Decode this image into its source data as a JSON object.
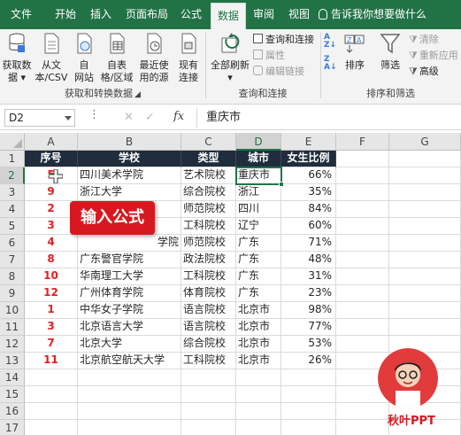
{
  "tabs": [
    "文件",
    "开始",
    "插入",
    "页面布局",
    "公式",
    "数据",
    "审阅",
    "视图"
  ],
  "active_tab": "数据",
  "tell_me": "告诉我你想要做什么",
  "ribbon": {
    "get_data": {
      "label1": "获取数",
      "label2": "据 ▾"
    },
    "from_text": {
      "label1": "从文",
      "label2": "本/CSV"
    },
    "from_web": {
      "label1": "自",
      "label2": "网站"
    },
    "from_table": {
      "label1": "自表",
      "label2": "格/区域"
    },
    "recent_sources": {
      "label1": "最近使",
      "label2": "用的源"
    },
    "existing_conn": {
      "label1": "现有",
      "label2": "连接"
    },
    "group1_label": "获取和转换数据",
    "refresh_all": {
      "label1": "全部刷新",
      "label2": "▾"
    },
    "queries_conn": "查询和连接",
    "properties": "属性",
    "edit_links": "编辑链接",
    "group2_label": "查询和连接",
    "sort": "排序",
    "filter": "筛选",
    "clear": "清除",
    "reapply": "重新应用",
    "advanced": "高级",
    "group3_label": "排序和筛选"
  },
  "formula_bar": {
    "name_box": "D2",
    "fx": "fx",
    "content": "重庆市"
  },
  "columns": [
    "A",
    "B",
    "C",
    "D",
    "E",
    "F",
    "G"
  ],
  "rows": [
    "1",
    "2",
    "3",
    "4",
    "5",
    "6",
    "7",
    "8",
    "9",
    "10",
    "11",
    "12",
    "13",
    "14",
    "15",
    "16",
    "17",
    "18"
  ],
  "sheet": {
    "headers": [
      "序号",
      "学校",
      "类型",
      "城市",
      "女生比例"
    ],
    "data": [
      [
        "5",
        "四川美术学院",
        "艺术院校",
        "重庆市",
        "66%"
      ],
      [
        "9",
        "浙江大学",
        "综合院校",
        "浙江",
        "35%"
      ],
      [
        "2",
        "",
        "师范院校",
        "四川",
        "84%"
      ],
      [
        "3",
        "",
        "工科院校",
        "辽宁",
        "60%"
      ],
      [
        "4",
        "学院",
        "师范院校",
        "广东",
        "71%"
      ],
      [
        "8",
        "广东警官学院",
        "政法院校",
        "广东",
        "48%"
      ],
      [
        "10",
        "华南理工大学",
        "工科院校",
        "广东",
        "31%"
      ],
      [
        "12",
        "广州体育学院",
        "体育院校",
        "广东",
        "23%"
      ],
      [
        "1",
        "中华女子学院",
        "语言院校",
        "北京市",
        "98%"
      ],
      [
        "3",
        "北京语言大学",
        "语言院校",
        "北京市",
        "77%"
      ],
      [
        "7",
        "北京大学",
        "综合院校",
        "北京市",
        "53%"
      ],
      [
        "11",
        "北京航空航天大学",
        "工科院校",
        "北京市",
        "26%"
      ]
    ]
  },
  "callout": "输入公式",
  "logo_text": "秋叶PPT",
  "colors": {
    "excel_green": "#217346",
    "header_fill": "#1f2d3d",
    "number_red": "#e02020",
    "callout_red": "#d7191f"
  }
}
